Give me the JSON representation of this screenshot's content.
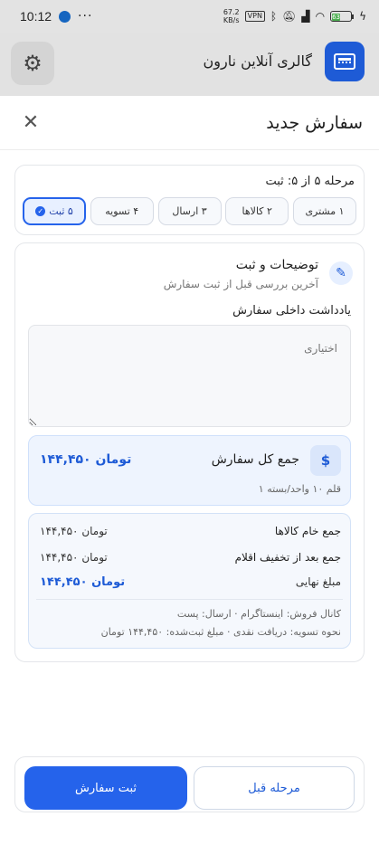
{
  "status_bar": {
    "time": "10:12",
    "dots": "···",
    "speed_value": "67.2",
    "speed_unit": "KB/s",
    "vpn": "VPN",
    "battery": "63"
  },
  "app_bar": {
    "title": "گالری آنلاین نارون"
  },
  "sheet": {
    "title": "سفارش جدید"
  },
  "stepper": {
    "current_text": "مرحله ۵ از ۵: ثبت",
    "steps": [
      {
        "label": "۱ مشتری"
      },
      {
        "label": "۲ کالاها"
      },
      {
        "label": "۳ ارسال"
      },
      {
        "label": "۴ تسویه"
      },
      {
        "label": "۵ ثبت"
      }
    ],
    "active_index": 4
  },
  "section": {
    "title": "توضیحات و ثبت",
    "subtitle": "آخرین بررسی قبل از ثبت سفارش",
    "note_label": "یادداشت داخلی سفارش",
    "note_placeholder": "اختیاری"
  },
  "total": {
    "label": "جمع کل سفارش",
    "value": "۱۴۴,۴۵۰ تومان",
    "sub": "۱ قلم ۱۰ واحد/بسته",
    "icon_glyph": "$"
  },
  "summary": {
    "rows": [
      {
        "label": "جمع خام کالاها",
        "value": "۱۴۴,۴۵۰ تومان"
      },
      {
        "label": "جمع بعد از تخفیف اقلام",
        "value": "۱۴۴,۴۵۰ تومان"
      },
      {
        "label": "مبلغ نهایی",
        "value": "۱۴۴,۴۵۰ تومان"
      }
    ],
    "meta_line1": "کانال فروش: اینستاگرام · ارسال: پست",
    "meta_line2": "نحوه تسویه: دریافت نقدی · مبلغ ثبت‌شده: ۱۴۴,۴۵۰ تومان"
  },
  "footer": {
    "prev_label": "مرحله قبل",
    "submit_label": "ثبت سفارش"
  },
  "colors": {
    "accent": "#2563eb",
    "logo": "#1e5bd6"
  }
}
